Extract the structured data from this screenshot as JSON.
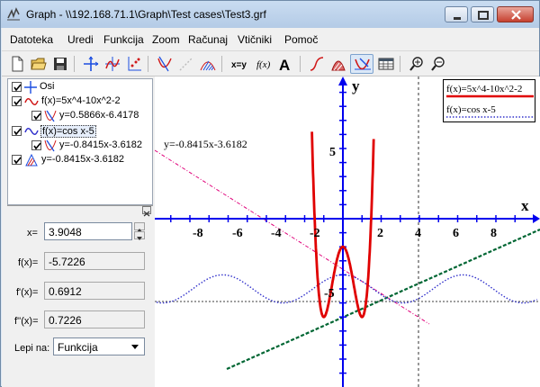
{
  "window": {
    "title": "Graph - \\\\192.168.71.1\\Graph\\Test cases\\Test3.grf",
    "menus": [
      "Datoteka",
      "Uredi",
      "Funkcija",
      "Zoom",
      "Računaj",
      "Vtičniki",
      "Pomoč"
    ]
  },
  "toolbar": {
    "icons": [
      "new-file",
      "open-folder",
      "save-disk",
      "axes-cross",
      "insert-function",
      "insert-points",
      "insert-tangent",
      "insert-shading",
      "insert-relation",
      "xy-evaluate",
      "fx-function",
      "text-label",
      "series-curve",
      "shade-area",
      "trace-evaluate",
      "table-view",
      "zoom-in",
      "zoom-out"
    ]
  },
  "tree": {
    "items": [
      {
        "label": "Osi",
        "checked": true,
        "level": 0,
        "icon": "axes-icon"
      },
      {
        "label": "f(x)=5x^4-10x^2-2",
        "checked": true,
        "level": 0,
        "icon": "function-curve-icon"
      },
      {
        "label": "y=0.5866x-6.4178",
        "checked": true,
        "level": 1,
        "icon": "tangent-icon"
      },
      {
        "label": "f(x)=cos x-5",
        "checked": true,
        "level": 0,
        "icon": "function-curve-icon"
      },
      {
        "label": "y=-0.8415x-3.6182",
        "checked": true,
        "level": 1,
        "icon": "tangent-icon"
      },
      {
        "label": "y=-0.8415x-3.6182",
        "checked": true,
        "level": 0,
        "icon": "relation-icon"
      }
    ]
  },
  "evaluate": {
    "x_label": "x=",
    "x_value": "3.9048",
    "fx_label": "f(x)=",
    "fx_value": "-5.7226",
    "f1_label": "f'(x)=",
    "f1_value": "0.6912",
    "f2_label": "f''(x)=",
    "f2_value": "0.7226",
    "snap_label": "Lepi na:",
    "snap_value": "Funkcija"
  },
  "graph": {
    "x_axis_label": "x",
    "y_axis_label": "y",
    "x_ticks": [
      "-8",
      "-6",
      "-4",
      "-2",
      "2",
      "4",
      "6",
      "8"
    ],
    "y_ticks": [
      "5",
      "-5"
    ],
    "annotation": "y=-0.8415x-3.6182",
    "legend": [
      "f(x)=5x^4-10x^2-2",
      "f(x)=cos x-5"
    ],
    "colors": {
      "axes": "#0000ee",
      "quartic": "#e00000",
      "cosine": "#3333cc",
      "tangent1": "#006633",
      "tangent2": "#e0007a"
    }
  }
}
